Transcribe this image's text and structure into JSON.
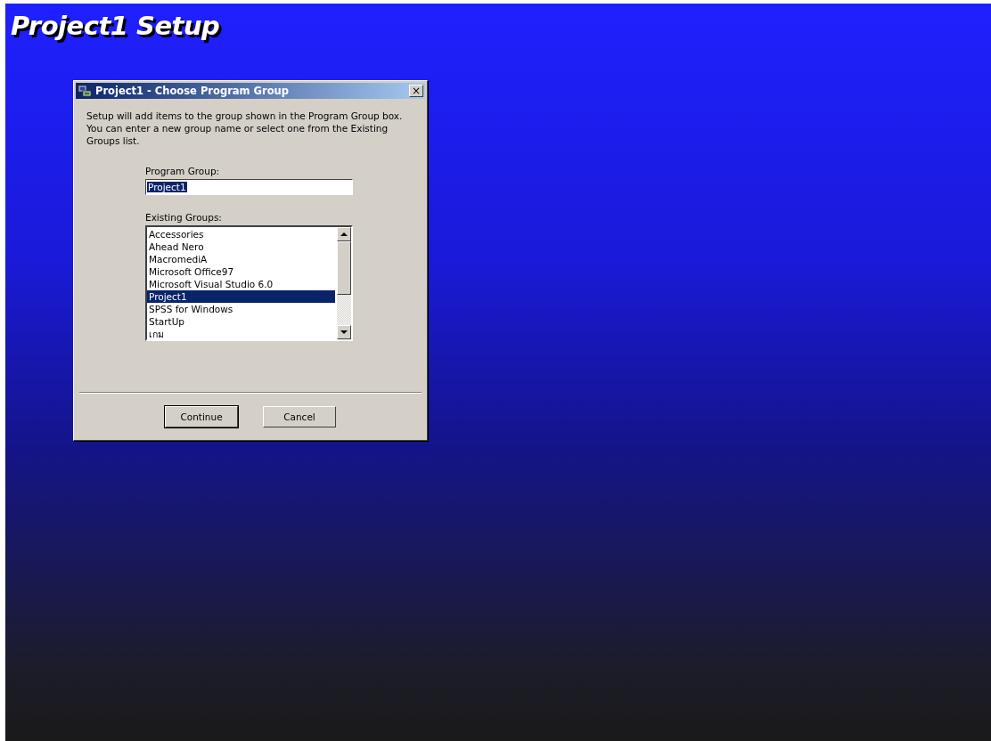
{
  "setup_title": "Project1 Setup",
  "dialog": {
    "title": "Project1 - Choose Program Group",
    "close": "×",
    "intro": "Setup will add items to the group shown in the Program Group box. You can enter a new group name or select one from the Existing Groups list.",
    "program_group": {
      "label": "Program Group:",
      "value": "Project1"
    },
    "existing_groups": {
      "label": "Existing Groups:",
      "items": [
        {
          "label": "Accessories",
          "selected": false
        },
        {
          "label": "Ahead Nero",
          "selected": false
        },
        {
          "label": "MacromediA",
          "selected": false
        },
        {
          "label": "Microsoft Office97",
          "selected": false
        },
        {
          "label": "Microsoft Visual Studio 6.0",
          "selected": false
        },
        {
          "label": "Project1",
          "selected": true
        },
        {
          "label": "SPSS for Windows",
          "selected": false
        },
        {
          "label": "StartUp",
          "selected": false
        },
        {
          "label": "เกม",
          "selected": false
        }
      ]
    },
    "buttons": [
      {
        "label": "Continue",
        "default": true
      },
      {
        "label": "Cancel",
        "default": false
      }
    ]
  }
}
